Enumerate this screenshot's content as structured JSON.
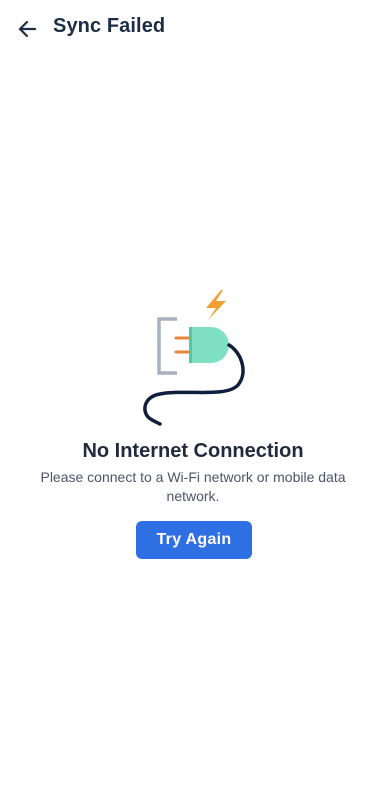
{
  "header": {
    "back_icon": "arrow-left-icon",
    "title": "Sync Failed"
  },
  "empty_state": {
    "illustration_icon": "unplugged-cable-icon",
    "title": "No Internet Connection",
    "message": "Please connect to a Wi-Fi network or mobile data network.",
    "retry_label": "Try Again"
  },
  "colors": {
    "accent": "#2f6fe4",
    "plug": "#7fe0c3",
    "bolt": "#f0a030",
    "prongs": "#e8873a",
    "cable": "#0f1f3d",
    "socket": "#a9b1bd"
  }
}
